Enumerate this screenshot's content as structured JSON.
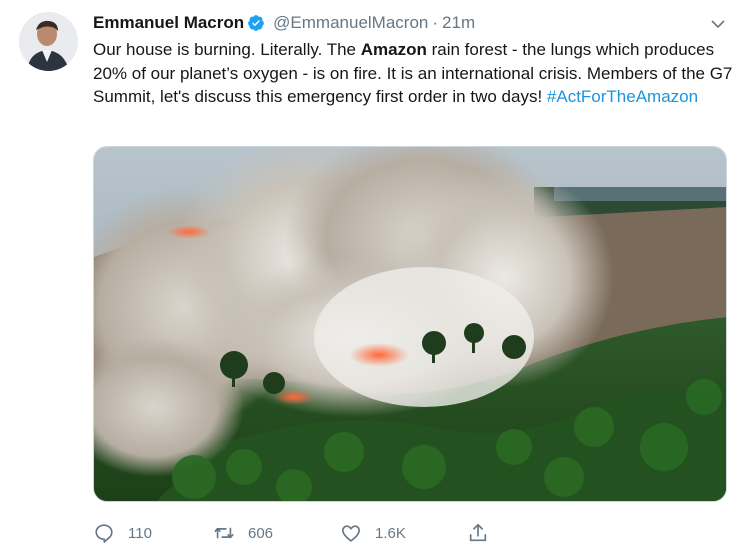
{
  "tweet": {
    "author_name": "Emmanuel Macron",
    "handle": "@EmmanuelMacron",
    "separator": "·",
    "time": "21m",
    "text_parts": {
      "p1": "Our house is burning. Literally. The ",
      "p2": "Amazon",
      "p3": " rain forest - the lungs which produces 20% of our planet’s oxygen - is on fire. It is an international crisis. Members of the G7 Summit, let's discuss this emergency first order in two days! ",
      "hashtag": "#ActForTheAmazon"
    },
    "media": {
      "icon": "photo-amazon-fire"
    },
    "actions": {
      "reply_count": "110",
      "retweet_count": "606",
      "like_count": "1.6K"
    }
  },
  "colors": {
    "link": "#1b95e0",
    "verified": "#1da1f2",
    "muted": "#657786"
  }
}
